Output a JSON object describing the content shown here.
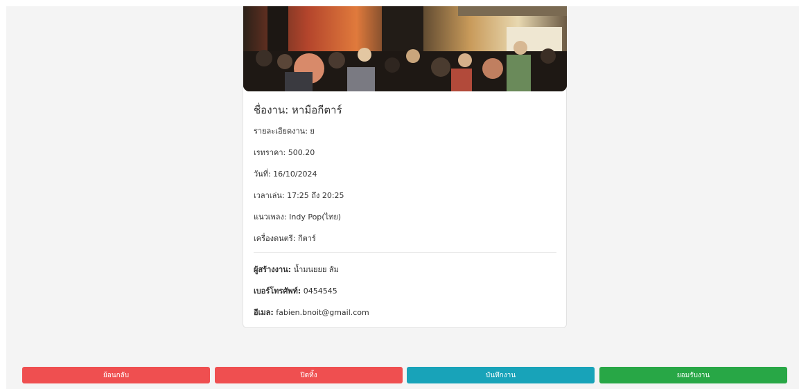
{
  "job": {
    "title_label": "ชื่องาน:",
    "title_value": "หามือกีตาร์",
    "detail_label": "รายละเอียดงาน:",
    "detail_value": "ย",
    "price_label": "เรทราคา:",
    "price_value": "500.20",
    "date_label": "วันที่:",
    "date_value": "16/10/2024",
    "time_label": "เวลาเล่น:",
    "time_value": "17:25 ถึง 20:25",
    "genre_label": "แนวเพลง:",
    "genre_value": "Indy Pop(ไทย)",
    "instrument_label": "เครื่องดนตรี:",
    "instrument_value": "กีตาร์"
  },
  "creator": {
    "name_label": "ผู้สร้างงาน:",
    "name_value": "น้ำมนยยย ส้ม",
    "phone_label": "เบอร์โทรศัพท์:",
    "phone_value": "0454545",
    "email_label": "อีเมล:",
    "email_value": "fabien.bnoit@gmail.com"
  },
  "actions": {
    "back_label": "ย้อนกลับ",
    "reject_label": "ปิดทิ้ง",
    "save_label": "บันทึกงาน",
    "accept_label": "ยอมรับงาน"
  },
  "colors": {
    "back": "#ef4f50",
    "reject": "#ef4f50",
    "save": "#18a3b9",
    "accept": "#28a746"
  },
  "icons": {
    "photo": "event-crowd-image"
  }
}
